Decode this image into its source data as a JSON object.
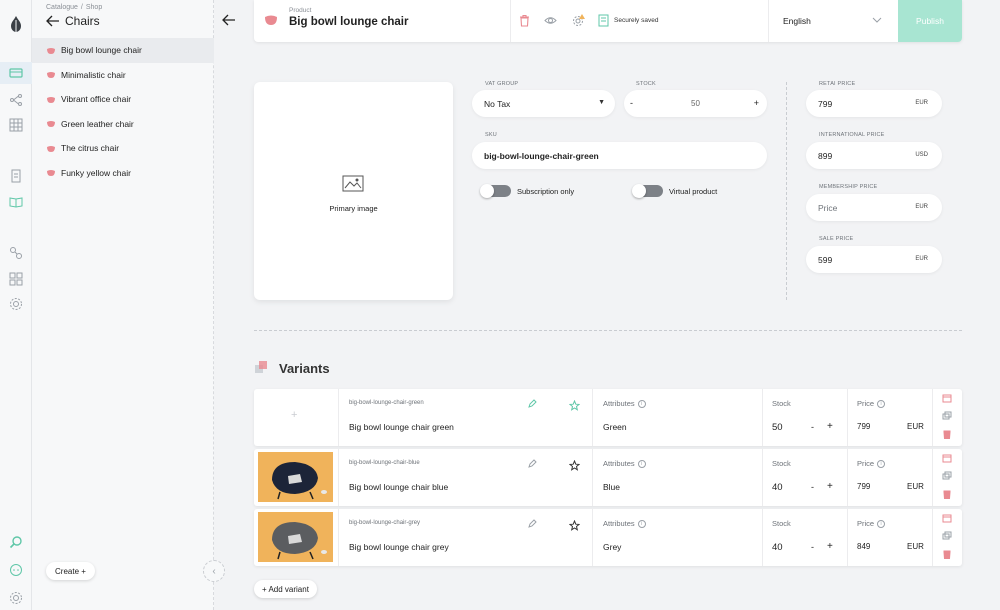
{
  "colors": {
    "accent": "#a8e5d2",
    "chair_pink": "#e98a91",
    "variant_bg": "#f0b35b"
  },
  "rail": {
    "icons": [
      "logo-icon",
      "catalogue-icon",
      "flow-icon",
      "grid-icon",
      "document-icon",
      "book-icon",
      "link-icon",
      "apps-icon",
      "settings-icon",
      "search-icon",
      "chat-icon",
      "gear-icon"
    ]
  },
  "sidebar": {
    "breadcrumb": [
      "Catalogue",
      "Shop"
    ],
    "title": "Chairs",
    "items": [
      {
        "label": "Big bowl lounge chair",
        "active": true
      },
      {
        "label": "Minimalistic chair"
      },
      {
        "label": "Vibrant office chair"
      },
      {
        "label": "Green leather chair"
      },
      {
        "label": "The citrus chair"
      },
      {
        "label": "Funky yellow chair"
      }
    ],
    "create_label": "Create +"
  },
  "header": {
    "label": "Product",
    "title": "Big bowl lounge chair",
    "saved_text": "Securely saved",
    "language": "English",
    "publish_label": "Publish"
  },
  "image": {
    "label": "Primary image"
  },
  "form": {
    "vat_group": {
      "label": "VAT GROUP",
      "value": "No Tax"
    },
    "stock": {
      "label": "STOCK",
      "value": "50",
      "minus": "-",
      "plus": "+"
    },
    "sku": {
      "label": "SKU",
      "value": "big-bowl-lounge-chair-green"
    },
    "subscription_label": "Subscription only",
    "virtual_label": "Virtual product"
  },
  "prices": {
    "retail": {
      "label": "RETAI PRICE",
      "value": "799",
      "currency": "EUR"
    },
    "international": {
      "label": "INTERNATIONAL PRICE",
      "value": "899",
      "currency": "USD"
    },
    "membership": {
      "label": "MEMBERSHIP PRICE",
      "placeholder": "Price",
      "currency": "EUR"
    },
    "sale": {
      "label": "SALE PRICE",
      "value": "599",
      "currency": "EUR"
    }
  },
  "variants": {
    "title": "Variants",
    "attributes_label": "Attributes",
    "stock_label": "Stock",
    "price_label": "Price",
    "minus": "-",
    "plus": "+",
    "add_label": "+ Add variant",
    "rows": [
      {
        "sku": "big-bowl-lounge-chair-green",
        "name": "Big bowl lounge chair green",
        "attribute": "Green",
        "stock": "50",
        "price": "799",
        "currency": "EUR",
        "has_image": false
      },
      {
        "sku": "big-bowl-lounge-chair-blue",
        "name": "Big bowl lounge chair blue",
        "attribute": "Blue",
        "stock": "40",
        "price": "799",
        "currency": "EUR",
        "has_image": true
      },
      {
        "sku": "big-bowl-lounge-chair-grey",
        "name": "Big bowl lounge chair grey",
        "attribute": "Grey",
        "stock": "40",
        "price": "849",
        "currency": "EUR",
        "has_image": true
      }
    ]
  }
}
